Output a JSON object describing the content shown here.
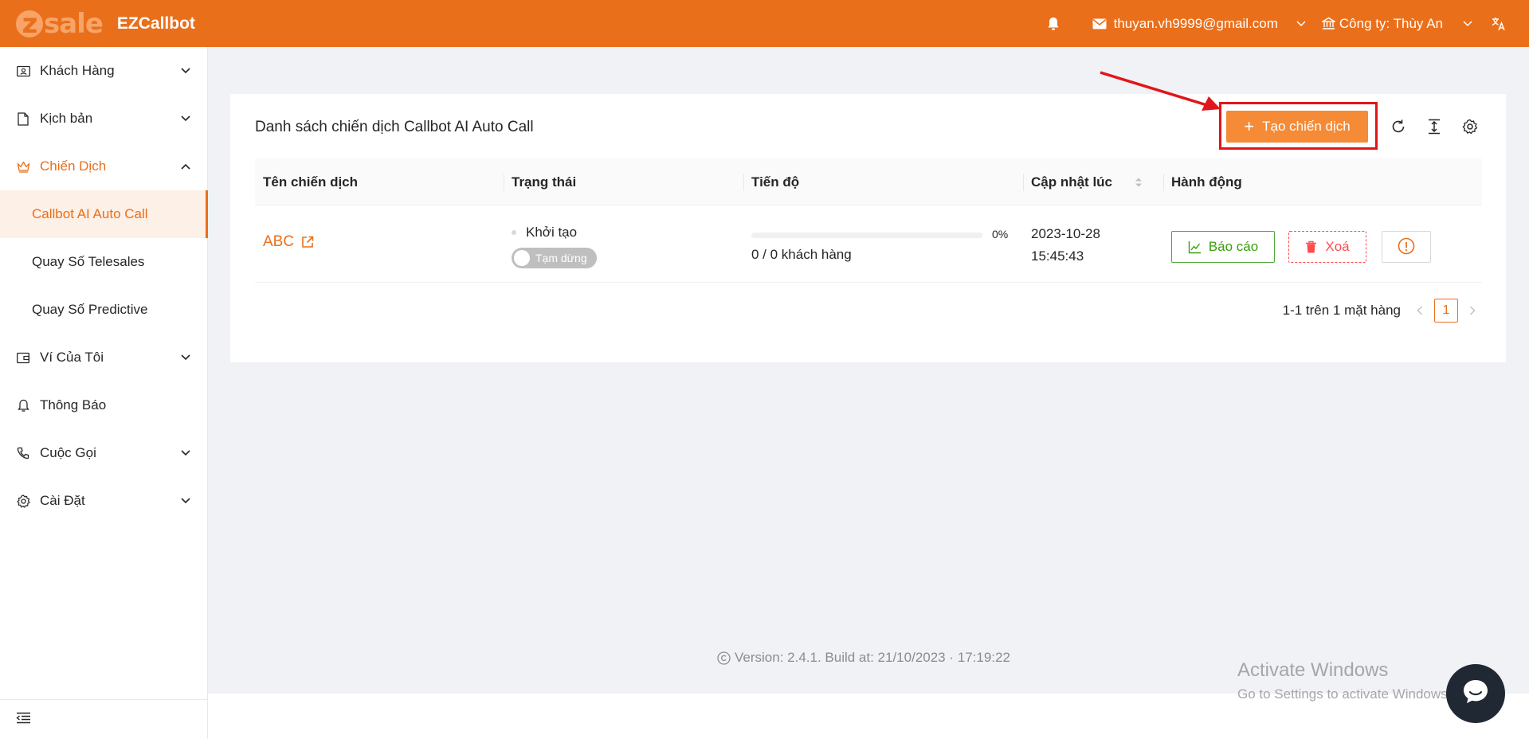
{
  "header": {
    "logo_text": "zsale",
    "logo_letter": "z",
    "app_name": "EZCallbot",
    "email": "thuyan.vh9999@gmail.com",
    "company": "Công ty: Thùy An"
  },
  "sidebar": {
    "items": [
      {
        "label": "Khách Hàng"
      },
      {
        "label": "Kịch bản"
      },
      {
        "label": "Chiến Dịch"
      },
      {
        "label": "Callbot AI Auto Call"
      },
      {
        "label": "Quay Số Telesales"
      },
      {
        "label": "Quay Số Predictive"
      },
      {
        "label": "Ví Của Tôi"
      },
      {
        "label": "Thông Báo"
      },
      {
        "label": "Cuộc Gọi"
      },
      {
        "label": "Cài Đặt"
      }
    ]
  },
  "main": {
    "title": "Danh sách chiến dịch Callbot AI Auto Call",
    "create_button": "Tạo chiến dịch",
    "table": {
      "columns": [
        "Tên chiến dịch",
        "Trạng thái",
        "Tiến độ",
        "Cập nhật lúc",
        "Hành động"
      ],
      "rows": [
        {
          "name": "ABC",
          "status": "Khởi tạo",
          "toggle_label": "Tạm dừng",
          "progress_percent": 0,
          "progress_label": "0%",
          "progress_count": "0 / 0 khách hàng",
          "updated_date": "2023-10-28",
          "updated_time": "15:45:43",
          "report_label": "Báo cáo",
          "delete_label": "Xoá"
        }
      ]
    },
    "pagination": {
      "summary": "1-1 trên 1 mặt hàng",
      "current_page": "1"
    }
  },
  "footer": {
    "version": "Version: 2.4.1. Build at: 21/10/2023 · 17:19:22"
  },
  "watermark": {
    "line1": "Activate Windows",
    "line2": "Go to Settings to activate Windows."
  },
  "colors": {
    "brand": "#ea6f1a",
    "create_button": "#f58b36",
    "highlight": "#e0161b",
    "success": "#52a53a",
    "danger": "#ff4d4f"
  }
}
